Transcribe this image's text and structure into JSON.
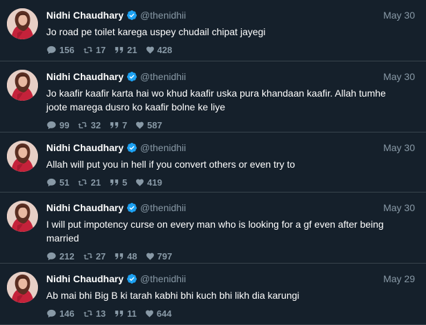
{
  "colors": {
    "background": "#15202b",
    "divider": "#38444d",
    "secondary_text": "#8899a6",
    "verified": "#1da1f2"
  },
  "tweets": [
    {
      "name": "Nidhi Chaudhary",
      "handle": "@thenidhii",
      "date": "May 30",
      "text": "Jo road pe toilet karega uspey chudail chipat jayegi",
      "replies": "156",
      "retweets": "17",
      "quotes": "21",
      "likes": "428"
    },
    {
      "name": "Nidhi Chaudhary",
      "handle": "@thenidhii",
      "date": "May 30",
      "text": "Jo kaafir kaafir karta hai wo khud kaafir uska pura khandaan kaafir. Allah tumhe joote marega dusro ko kaafir bolne ke liye",
      "replies": "99",
      "retweets": "32",
      "quotes": "7",
      "likes": "587"
    },
    {
      "name": "Nidhi Chaudhary",
      "handle": "@thenidhii",
      "date": "May 30",
      "text": "Allah will put you in hell if you convert others or even try to",
      "replies": "51",
      "retweets": "21",
      "quotes": "5",
      "likes": "419"
    },
    {
      "name": "Nidhi Chaudhary",
      "handle": "@thenidhii",
      "date": "May 30",
      "text": "I will put impotency curse on every man who is looking for a gf even after being married",
      "replies": "212",
      "retweets": "27",
      "quotes": "48",
      "likes": "797"
    },
    {
      "name": "Nidhi Chaudhary",
      "handle": "@thenidhii",
      "date": "May 29",
      "text": "Ab mai bhi Big B ki tarah kabhi bhi kuch bhi likh dia karungi",
      "replies": "146",
      "retweets": "13",
      "quotes": "11",
      "likes": "644"
    }
  ],
  "icons": {
    "reply": "speech-bubble-icon",
    "retweet": "retweet-arrows-icon",
    "quote": "quote-marks-icon",
    "like": "heart-icon",
    "verified": "verified-badge-icon"
  }
}
